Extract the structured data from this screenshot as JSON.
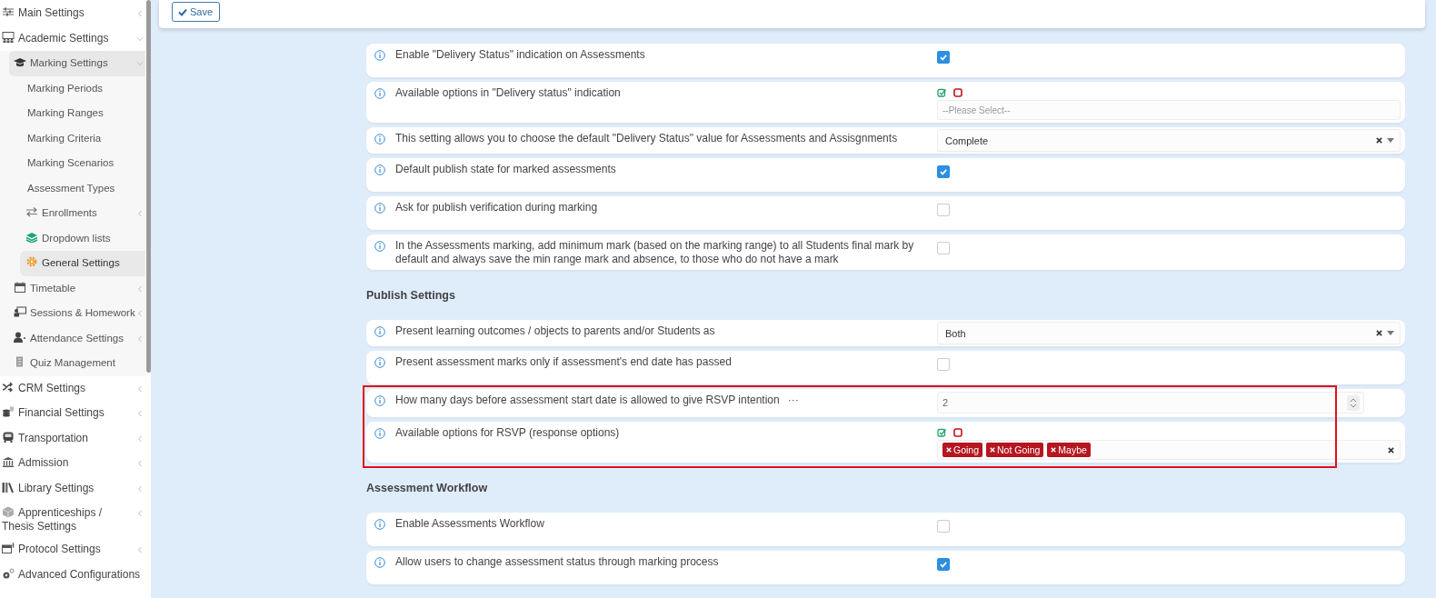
{
  "header": {
    "save_label": "Save"
  },
  "sidebar": {
    "items": [
      {
        "label": "Main Settings",
        "expanded": false,
        "selected": false
      },
      {
        "label": "Academic Settings",
        "expanded": true,
        "selected": false,
        "children": [
          {
            "label": "Marking Settings",
            "expanded": true,
            "selected": false,
            "children": [
              {
                "label": "Marking Periods",
                "selected": false
              },
              {
                "label": "Marking Ranges",
                "selected": false
              },
              {
                "label": "Marking Criteria",
                "selected": false
              },
              {
                "label": "Marking Scenarios",
                "selected": false
              },
              {
                "label": "Assessment Types",
                "selected": false
              },
              {
                "label": "Enrollments",
                "expanded": false,
                "selected": false
              },
              {
                "label": "Dropdown lists",
                "selected": false
              },
              {
                "label": "General Settings",
                "selected": true
              }
            ]
          },
          {
            "label": "Timetable",
            "expanded": false,
            "selected": false
          },
          {
            "label": "Sessions & Homework",
            "expanded": false,
            "selected": false
          },
          {
            "label": "Attendance Settings",
            "expanded": false,
            "selected": false
          },
          {
            "label": "Quiz Management",
            "selected": false
          }
        ]
      },
      {
        "label": "CRM Settings",
        "expanded": false,
        "selected": false
      },
      {
        "label": "Financial Settings",
        "expanded": false,
        "selected": false
      },
      {
        "label": "Transportation",
        "expanded": false,
        "selected": false
      },
      {
        "label": "Admission",
        "expanded": false,
        "selected": false
      },
      {
        "label": "Library Settings",
        "expanded": false,
        "selected": false
      },
      {
        "label": "Apprenticeships / Thesis Settings",
        "expanded": false,
        "selected": false
      },
      {
        "label": "Protocol Settings",
        "expanded": false,
        "selected": false
      },
      {
        "label": "Advanced Configurations",
        "selected": false
      }
    ]
  },
  "sections": [
    {
      "rows": [
        {
          "kind": "checkbox",
          "label": "Enable \"Delivery Status\" indication on Assessments",
          "checked": true,
          "highlighted": false
        },
        {
          "kind": "multiselect",
          "label": "Available options in \"Delivery status\" indication",
          "placeholder": "--Please Select--",
          "highlighted": false
        },
        {
          "kind": "select",
          "label": "This setting allows you to choose the default \"Delivery Status\" value for Assessments and Assisgnments",
          "value": "Complete",
          "highlighted": false
        },
        {
          "kind": "checkbox",
          "label": "Default publish state for marked assessments",
          "checked": true,
          "highlighted": false
        },
        {
          "kind": "checkbox",
          "label": "Ask for publish verification during marking",
          "checked": false,
          "highlighted": false
        },
        {
          "kind": "checkbox",
          "label": "In the Assessments marking, add minimum mark (based on the marking range) to all Students final mark by default and always save the min range mark and absence, to those who do not have a mark",
          "checked": false,
          "highlighted": false
        }
      ]
    },
    {
      "heading": "Publish Settings",
      "rows": [
        {
          "kind": "select",
          "label": "Present learning outcomes / objects to parents and/or Students as",
          "value": "Both",
          "highlighted": false
        },
        {
          "kind": "checkbox",
          "label": "Present assessment marks only if assessment's end date has passed",
          "checked": false,
          "highlighted": false
        },
        {
          "kind": "number",
          "label": "How many days before assessment start date is allowed to give RSVP intention",
          "more": "···",
          "value": "2",
          "highlighted": true
        },
        {
          "kind": "multiselect",
          "label": "Available options for RSVP (response options)",
          "tags": [
            "Going",
            "Not Going",
            "Maybe"
          ],
          "highlighted": true
        }
      ]
    },
    {
      "heading": "Assessment Workflow",
      "rows": [
        {
          "kind": "checkbox",
          "label": "Enable Assessments Workflow",
          "checked": false,
          "highlighted": false
        },
        {
          "kind": "checkbox",
          "label": "Allow users to change assessment status through marking process",
          "checked": true,
          "highlighted": false
        }
      ]
    }
  ]
}
